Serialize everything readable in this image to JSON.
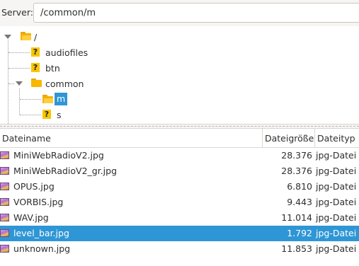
{
  "server": {
    "label": "Server:",
    "path_value": "/common/m"
  },
  "tree": {
    "nodes": [
      {
        "label": "/",
        "icon": "folder-open-icon",
        "expanded": true
      },
      {
        "label": "audiofiles",
        "icon": "unknown-folder-icon"
      },
      {
        "label": "btn",
        "icon": "unknown-folder-icon"
      },
      {
        "label": "common",
        "icon": "folder-icon",
        "expanded": true
      },
      {
        "label": "m",
        "icon": "folder-open-icon",
        "selected": true
      },
      {
        "label": "s",
        "icon": "unknown-folder-icon"
      }
    ]
  },
  "files": {
    "columns": {
      "name": "Dateiname",
      "size": "Dateigröße",
      "type": "Dateityp"
    },
    "rows": [
      {
        "name": "MiniWebRadioV2.jpg",
        "size": "28.376",
        "type": "jpg-Datei",
        "selected": false
      },
      {
        "name": "MiniWebRadioV2_gr.jpg",
        "size": "28.376",
        "type": "jpg-Datei",
        "selected": false
      },
      {
        "name": "OPUS.jpg",
        "size": "6.810",
        "type": "jpg-Datei",
        "selected": false
      },
      {
        "name": "VORBIS.jpg",
        "size": "9.443",
        "type": "jpg-Datei",
        "selected": false
      },
      {
        "name": "WAV.jpg",
        "size": "11.014",
        "type": "jpg-Datei",
        "selected": false
      },
      {
        "name": "level_bar.jpg",
        "size": "1.792",
        "type": "jpg-Datei",
        "selected": true
      },
      {
        "name": "unknown.jpg",
        "size": "11.853",
        "type": "jpg-Datei",
        "selected": false
      }
    ]
  },
  "colors": {
    "selection": "#2f96d6",
    "folder": "#f7b800"
  }
}
